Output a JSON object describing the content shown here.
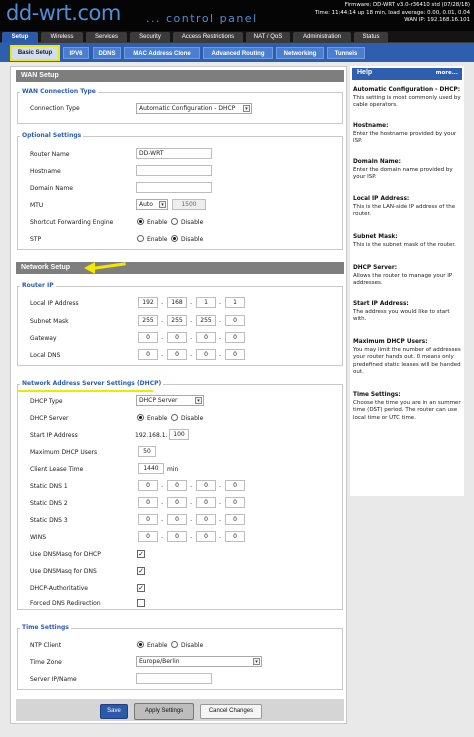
{
  "header": {
    "logo": "dd-wrt.com",
    "subtitle": "... control panel",
    "firmware": "Firmware: DD-WRT v3.0-r36410 std (07/28/18)",
    "time": "Time: 11:44:14 up 18 min, load average: 0.00, 0.01, 0.04",
    "wan_ip": "WAN IP: 192.168.16.101"
  },
  "main_tabs": [
    "Setup",
    "Wireless",
    "Services",
    "Security",
    "Access Restrictions",
    "NAT / QoS",
    "Administration",
    "Status"
  ],
  "sub_tabs": [
    "Basic Setup",
    "IPV6",
    "DDNS",
    "MAC Address Clone",
    "Advanced Routing",
    "Networking",
    "Tunnels"
  ],
  "wan": {
    "header": "WAN Setup",
    "conn_type_title": "WAN Connection Type",
    "conn_type_label": "Connection Type",
    "conn_type_value": "Automatic Configuration - DHCP",
    "optional_title": "Optional Settings",
    "router_name_label": "Router Name",
    "router_name_value": "DD-WRT",
    "hostname_label": "Hostname",
    "hostname_value": "",
    "domain_label": "Domain Name",
    "domain_value": "",
    "mtu_label": "MTU",
    "mtu_mode": "Auto",
    "mtu_value": "1500",
    "sfe_label": "Shortcut Forwarding Engine",
    "stp_label": "STP",
    "enable": "Enable",
    "disable": "Disable"
  },
  "network": {
    "header": "Network Setup",
    "router_ip_title": "Router IP",
    "local_ip_label": "Local IP Address",
    "local_ip": [
      "192",
      "168",
      "1",
      "1"
    ],
    "subnet_label": "Subnet Mask",
    "subnet": [
      "255",
      "255",
      "255",
      "0"
    ],
    "gateway_label": "Gateway",
    "gateway": [
      "0",
      "0",
      "0",
      "0"
    ],
    "local_dns_label": "Local DNS",
    "local_dns": [
      "0",
      "0",
      "0",
      "0"
    ]
  },
  "nass": {
    "title": "Network Address Server Settings (DHCP)",
    "dhcp_type_label": "DHCP Type",
    "dhcp_type_value": "DHCP Server",
    "dhcp_server_label": "DHCP Server",
    "start_ip_label": "Start IP Address",
    "start_ip_prefix": "192.168.1.",
    "start_ip_value": "100",
    "max_users_label": "Maximum DHCP Users",
    "max_users_value": "50",
    "lease_label": "Client Lease Time",
    "lease_value": "1440",
    "lease_unit": "min",
    "dns1_label": "Static DNS 1",
    "dns1": [
      "0",
      "0",
      "0",
      "0"
    ],
    "dns2_label": "Static DNS 2",
    "dns2": [
      "0",
      "0",
      "0",
      "0"
    ],
    "dns3_label": "Static DNS 3",
    "dns3": [
      "0",
      "0",
      "0",
      "0"
    ],
    "wins_label": "WINS",
    "wins": [
      "0",
      "0",
      "0",
      "0"
    ],
    "dnsmasq_dhcp_label": "Use DNSMasq for DHCP",
    "dnsmasq_dns_label": "Use DNSMasq for DNS",
    "dhcp_auth_label": "DHCP-Authoritative",
    "forced_dns_label": "Forced DNS Redirection"
  },
  "time": {
    "title": "Time Settings",
    "ntp_label": "NTP Client",
    "tz_label": "Time Zone",
    "tz_value": "Europe/Berlin",
    "server_label": "Server IP/Name",
    "server_value": ""
  },
  "buttons": {
    "save": "Save",
    "apply": "Apply Settings",
    "cancel": "Cancel Changes"
  },
  "help": {
    "title": "Help",
    "more": "more...",
    "items": [
      {
        "title": "Automatic Configuration - DHCP:",
        "text": "This setting is most commonly used by cable operators."
      },
      {
        "title": "Hostname:",
        "text": "Enter the hostname provided by your ISP."
      },
      {
        "title": "Domain Name:",
        "text": "Enter the domain name provided by your ISP."
      },
      {
        "title": "Local IP Address:",
        "text": "This is the LAN-side IP address of the router."
      },
      {
        "title": "Subnet Mask:",
        "text": "This is the subnet mask of the router."
      },
      {
        "title": "DHCP Server:",
        "text": "Allows the router to manage your IP addresses."
      },
      {
        "title": "Start IP Address:",
        "text": "The address you would like to start with."
      },
      {
        "title": "Maximum DHCP Users:",
        "text": "You may limit the number of addresses your router hands out. 0 means only predefined static leases will be handed out."
      },
      {
        "title": "Time Settings:",
        "text": "Choose the time you are in an summer time (DST) period. The router can use local time or UTC time."
      }
    ]
  }
}
